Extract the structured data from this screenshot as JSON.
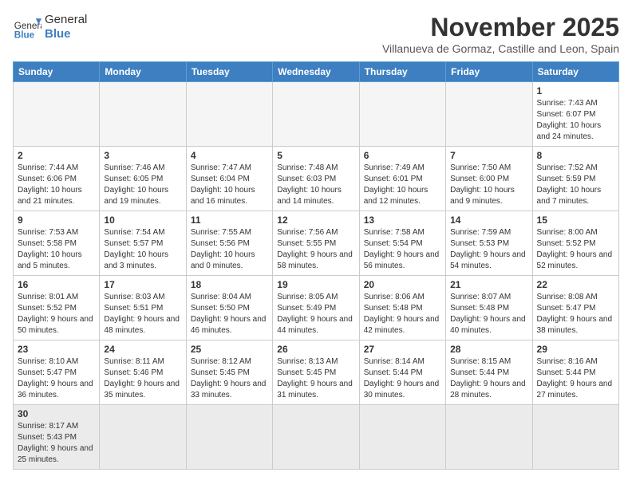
{
  "header": {
    "logo_general": "General",
    "logo_blue": "Blue",
    "month_title": "November 2025",
    "subtitle": "Villanueva de Gormaz, Castille and Leon, Spain"
  },
  "weekdays": [
    "Sunday",
    "Monday",
    "Tuesday",
    "Wednesday",
    "Thursday",
    "Friday",
    "Saturday"
  ],
  "weeks": [
    [
      {
        "day": "",
        "info": ""
      },
      {
        "day": "",
        "info": ""
      },
      {
        "day": "",
        "info": ""
      },
      {
        "day": "",
        "info": ""
      },
      {
        "day": "",
        "info": ""
      },
      {
        "day": "",
        "info": ""
      },
      {
        "day": "1",
        "info": "Sunrise: 7:43 AM\nSunset: 6:07 PM\nDaylight: 10 hours and 24 minutes."
      }
    ],
    [
      {
        "day": "2",
        "info": "Sunrise: 7:44 AM\nSunset: 6:06 PM\nDaylight: 10 hours and 21 minutes."
      },
      {
        "day": "3",
        "info": "Sunrise: 7:46 AM\nSunset: 6:05 PM\nDaylight: 10 hours and 19 minutes."
      },
      {
        "day": "4",
        "info": "Sunrise: 7:47 AM\nSunset: 6:04 PM\nDaylight: 10 hours and 16 minutes."
      },
      {
        "day": "5",
        "info": "Sunrise: 7:48 AM\nSunset: 6:03 PM\nDaylight: 10 hours and 14 minutes."
      },
      {
        "day": "6",
        "info": "Sunrise: 7:49 AM\nSunset: 6:01 PM\nDaylight: 10 hours and 12 minutes."
      },
      {
        "day": "7",
        "info": "Sunrise: 7:50 AM\nSunset: 6:00 PM\nDaylight: 10 hours and 9 minutes."
      },
      {
        "day": "8",
        "info": "Sunrise: 7:52 AM\nSunset: 5:59 PM\nDaylight: 10 hours and 7 minutes."
      }
    ],
    [
      {
        "day": "9",
        "info": "Sunrise: 7:53 AM\nSunset: 5:58 PM\nDaylight: 10 hours and 5 minutes."
      },
      {
        "day": "10",
        "info": "Sunrise: 7:54 AM\nSunset: 5:57 PM\nDaylight: 10 hours and 3 minutes."
      },
      {
        "day": "11",
        "info": "Sunrise: 7:55 AM\nSunset: 5:56 PM\nDaylight: 10 hours and 0 minutes."
      },
      {
        "day": "12",
        "info": "Sunrise: 7:56 AM\nSunset: 5:55 PM\nDaylight: 9 hours and 58 minutes."
      },
      {
        "day": "13",
        "info": "Sunrise: 7:58 AM\nSunset: 5:54 PM\nDaylight: 9 hours and 56 minutes."
      },
      {
        "day": "14",
        "info": "Sunrise: 7:59 AM\nSunset: 5:53 PM\nDaylight: 9 hours and 54 minutes."
      },
      {
        "day": "15",
        "info": "Sunrise: 8:00 AM\nSunset: 5:52 PM\nDaylight: 9 hours and 52 minutes."
      }
    ],
    [
      {
        "day": "16",
        "info": "Sunrise: 8:01 AM\nSunset: 5:52 PM\nDaylight: 9 hours and 50 minutes."
      },
      {
        "day": "17",
        "info": "Sunrise: 8:03 AM\nSunset: 5:51 PM\nDaylight: 9 hours and 48 minutes."
      },
      {
        "day": "18",
        "info": "Sunrise: 8:04 AM\nSunset: 5:50 PM\nDaylight: 9 hours and 46 minutes."
      },
      {
        "day": "19",
        "info": "Sunrise: 8:05 AM\nSunset: 5:49 PM\nDaylight: 9 hours and 44 minutes."
      },
      {
        "day": "20",
        "info": "Sunrise: 8:06 AM\nSunset: 5:48 PM\nDaylight: 9 hours and 42 minutes."
      },
      {
        "day": "21",
        "info": "Sunrise: 8:07 AM\nSunset: 5:48 PM\nDaylight: 9 hours and 40 minutes."
      },
      {
        "day": "22",
        "info": "Sunrise: 8:08 AM\nSunset: 5:47 PM\nDaylight: 9 hours and 38 minutes."
      }
    ],
    [
      {
        "day": "23",
        "info": "Sunrise: 8:10 AM\nSunset: 5:47 PM\nDaylight: 9 hours and 36 minutes."
      },
      {
        "day": "24",
        "info": "Sunrise: 8:11 AM\nSunset: 5:46 PM\nDaylight: 9 hours and 35 minutes."
      },
      {
        "day": "25",
        "info": "Sunrise: 8:12 AM\nSunset: 5:45 PM\nDaylight: 9 hours and 33 minutes."
      },
      {
        "day": "26",
        "info": "Sunrise: 8:13 AM\nSunset: 5:45 PM\nDaylight: 9 hours and 31 minutes."
      },
      {
        "day": "27",
        "info": "Sunrise: 8:14 AM\nSunset: 5:44 PM\nDaylight: 9 hours and 30 minutes."
      },
      {
        "day": "28",
        "info": "Sunrise: 8:15 AM\nSunset: 5:44 PM\nDaylight: 9 hours and 28 minutes."
      },
      {
        "day": "29",
        "info": "Sunrise: 8:16 AM\nSunset: 5:44 PM\nDaylight: 9 hours and 27 minutes."
      }
    ],
    [
      {
        "day": "30",
        "info": "Sunrise: 8:17 AM\nSunset: 5:43 PM\nDaylight: 9 hours and 25 minutes."
      },
      {
        "day": "",
        "info": ""
      },
      {
        "day": "",
        "info": ""
      },
      {
        "day": "",
        "info": ""
      },
      {
        "day": "",
        "info": ""
      },
      {
        "day": "",
        "info": ""
      },
      {
        "day": "",
        "info": ""
      }
    ]
  ]
}
